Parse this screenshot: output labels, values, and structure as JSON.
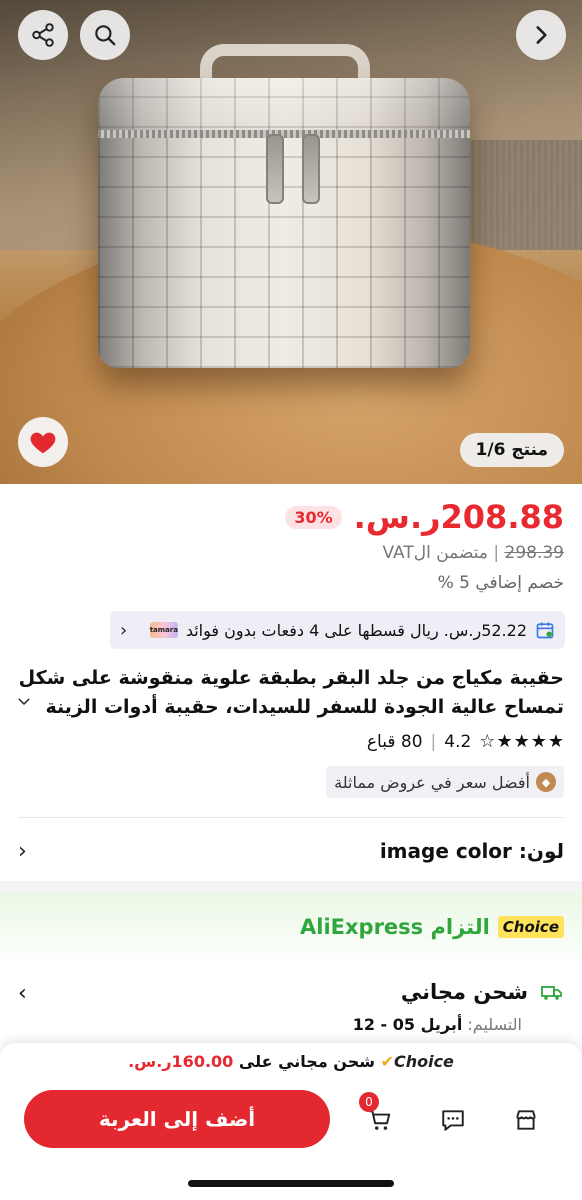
{
  "gallery": {
    "counter": "منتج 1/6",
    "image_alt": "crocodile embossed makeup bag"
  },
  "price": {
    "current": "208.88ر.س.",
    "discount": "30%",
    "old": "298.39",
    "vat": "متضمن الVAT",
    "extra_discount": "خصم إضافي 5 %"
  },
  "tamara": {
    "logo_text": "tamara",
    "text": "52.22ر.س. ريال قسطها على 4 دفعات بدون فوائد"
  },
  "product": {
    "title": "حقيبة مكياج من جلد البقر بطبقة علوية منقوشة على شكل تمساح عالية الجودة للسفر للسيدات، حقيبة أدوات الزينة",
    "rating": "4.2",
    "sold": "80 قباع",
    "stars": [
      "★",
      "★",
      "★",
      "★",
      "☆"
    ],
    "best_price": "أفضل سعر في عروض مماثلة"
  },
  "color": {
    "label": "لون:",
    "value": "image color"
  },
  "choice": {
    "badge": "Choice",
    "text": "التزام AliExpress"
  },
  "shipping": {
    "title": "شحن مجاني",
    "delivery_label": "التسليم:",
    "delivery_dates": "أبريل 05 - 12"
  },
  "bottom": {
    "promo_badge": "Choice",
    "promo_text": "شحن مجاني على",
    "promo_amount": "160.00ر.س.",
    "cart_count": "0",
    "add_to_cart": "أضف إلى العربة"
  },
  "colors": {
    "accent": "#e3282f",
    "choice_green": "#2fa73c",
    "choice_yellow": "#ffe35a"
  }
}
